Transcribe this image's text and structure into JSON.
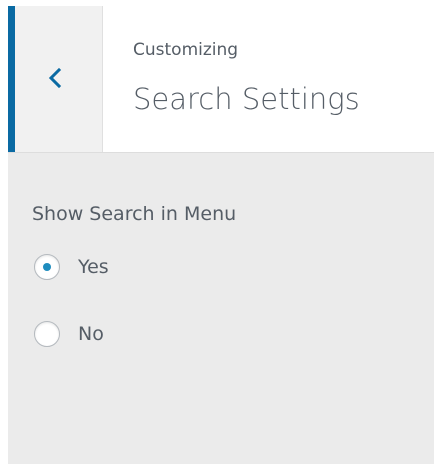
{
  "header": {
    "subtitle": "Customizing",
    "title": "Search Settings",
    "accent_color": "#0a6aa3"
  },
  "section": {
    "label": "Show Search in Menu",
    "options": [
      {
        "label": "Yes",
        "selected": true
      },
      {
        "label": "No",
        "selected": false
      }
    ]
  },
  "icons": {
    "back": "chevron-left-icon"
  }
}
